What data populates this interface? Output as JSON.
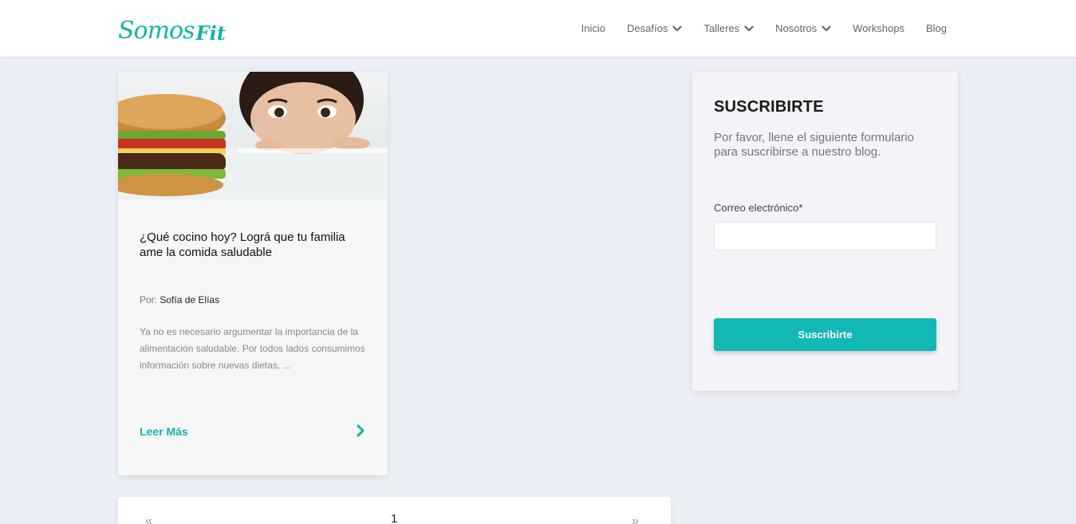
{
  "header": {
    "logo": {
      "part1": "Somos",
      "part2": "Fit"
    },
    "nav": [
      {
        "label": "Inicio",
        "dropdown": false
      },
      {
        "label": "Desafíos",
        "dropdown": true
      },
      {
        "label": "Talleres",
        "dropdown": true
      },
      {
        "label": "Nosotros",
        "dropdown": true
      },
      {
        "label": "Workshops",
        "dropdown": false
      },
      {
        "label": "Blog",
        "dropdown": false
      }
    ]
  },
  "post": {
    "title": "¿Qué cocino hoy? Lográ que tu familia ame la comida saludable",
    "author_prefix": "Por:",
    "author": "Sofía de Elías",
    "excerpt": "Ya no es necesario argumentar la importancia de la alimentación saludable. Por todos lados consumimos información sobre nuevas dietas, ...",
    "read_more": "Leer Más"
  },
  "subscribe": {
    "title": "SUSCRIBIRTE",
    "description": "Por favor, llene el siguiente formulario para suscribirse a nuestro blog.",
    "email_label": "Correo electrónico*",
    "email_value": "",
    "button": "Suscribirte"
  },
  "pagination": {
    "prev": "«",
    "current": "1",
    "next": "»"
  },
  "colors": {
    "accent": "#12b8b3",
    "background": "#eceef6"
  }
}
